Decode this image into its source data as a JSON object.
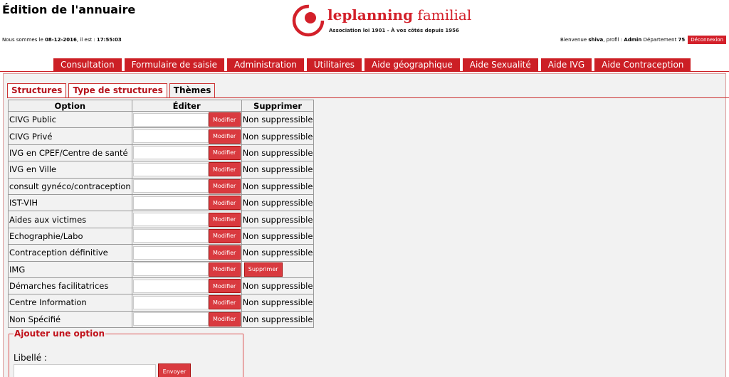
{
  "header": {
    "title": "Édition de l'annuaire",
    "datetime_prefix": "Nous sommes le ",
    "date": "08-12-2016",
    "time_prefix": ", il est : ",
    "time": "17:55:03",
    "logo_text_bold": "leplanning",
    "logo_text_regular": " familial",
    "logo_tagline": "Association loi 1901 - À vos côtés depuis 1956",
    "welcome_prefix": "Bienvenue ",
    "user": "shiva",
    "profile_prefix": ", profil : ",
    "profile": "Admin",
    "dept_prefix": " Département ",
    "department": "75",
    "logout_label": "Déconnexion"
  },
  "menu": [
    "Consultation",
    "Formulaire de saisie",
    "Administration",
    "Utilitaires",
    "Aide géographique",
    "Aide Sexualité",
    "Aide IVG",
    "Aide Contraception"
  ],
  "tabs": [
    {
      "label": "Structures",
      "active": false
    },
    {
      "label": "Type de structures",
      "active": false
    },
    {
      "label": "Thèmes",
      "active": true
    }
  ],
  "table": {
    "headers": [
      "Option",
      "Éditer",
      "Supprimer"
    ],
    "modify_label": "Modifier",
    "delete_label": "Supprimer",
    "rows": [
      {
        "option": "CIVG Public",
        "delete": "Non suppressible"
      },
      {
        "option": "CIVG Privé",
        "delete": "Non suppressible"
      },
      {
        "option": "IVG en CPEF/Centre de santé",
        "delete": "Non suppressible"
      },
      {
        "option": "IVG en Ville",
        "delete": "Non suppressible"
      },
      {
        "option": "consult gynéco/contraception",
        "delete": "Non suppressible"
      },
      {
        "option": "IST-VIH",
        "delete": "Non suppressible"
      },
      {
        "option": "Aides aux victimes",
        "delete": "Non suppressible"
      },
      {
        "option": "Echographie/Labo",
        "delete": "Non suppressible"
      },
      {
        "option": "Contraception définitive",
        "delete": "Non suppressible"
      },
      {
        "option": "IMG",
        "delete": "button"
      },
      {
        "option": "Démarches facilitatrices",
        "delete": "Non suppressible"
      },
      {
        "option": "Centre Information",
        "delete": "Non suppressible"
      },
      {
        "option": "Non Spécifié",
        "delete": "Non suppressible"
      }
    ]
  },
  "add_option": {
    "legend": "Ajouter une option",
    "label": "Libellé :",
    "submit_label": "Envoyer"
  },
  "colors": {
    "accent": "#cc1f25"
  }
}
